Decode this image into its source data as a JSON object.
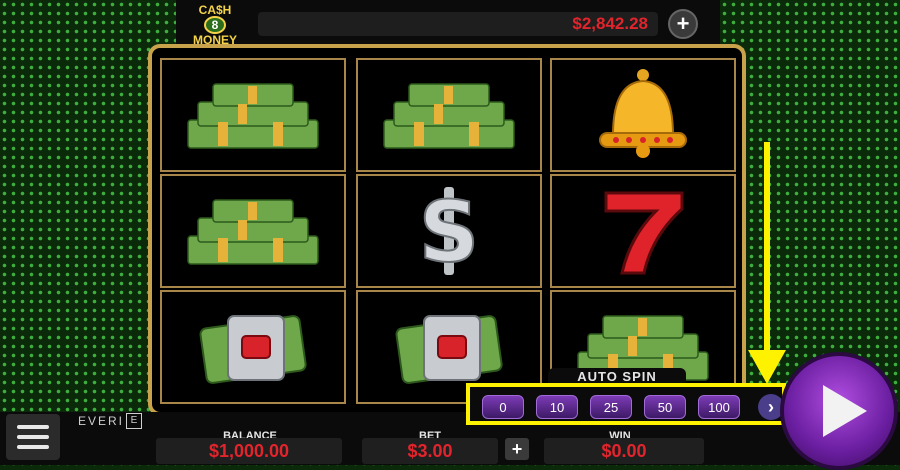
{
  "header": {
    "logo": {
      "line1": "CA$H",
      "number": "8",
      "line2": "MONEY"
    },
    "balance_display": "$2,842.28"
  },
  "reels": [
    [
      "cash-stack-symbol",
      "cash-stack-symbol",
      "golden-bell-symbol"
    ],
    [
      "cash-stack-symbol",
      "diamond-dollar-symbol",
      "red-seven-symbol"
    ],
    [
      "money-clip-ruby-symbol",
      "money-clip-ruby-symbol",
      "cash-stack-symbol"
    ]
  ],
  "auto_spin": {
    "label": "AUTO SPIN",
    "options": [
      "0",
      "10",
      "25",
      "50",
      "100"
    ],
    "next_icon": "chevron-right-icon"
  },
  "footer": {
    "brand": "EVERI",
    "balance": {
      "label": "BALANCE",
      "value": "$1,000.00"
    },
    "bet": {
      "label": "BET",
      "value": "$3.00"
    },
    "win": {
      "label": "WIN",
      "value": "$0.00"
    }
  },
  "colors": {
    "accent_red": "#e2242c",
    "highlight_yellow": "#fff200",
    "spin_purple": "#8a2bc2",
    "reel_border_gold": "#c9a24c"
  }
}
